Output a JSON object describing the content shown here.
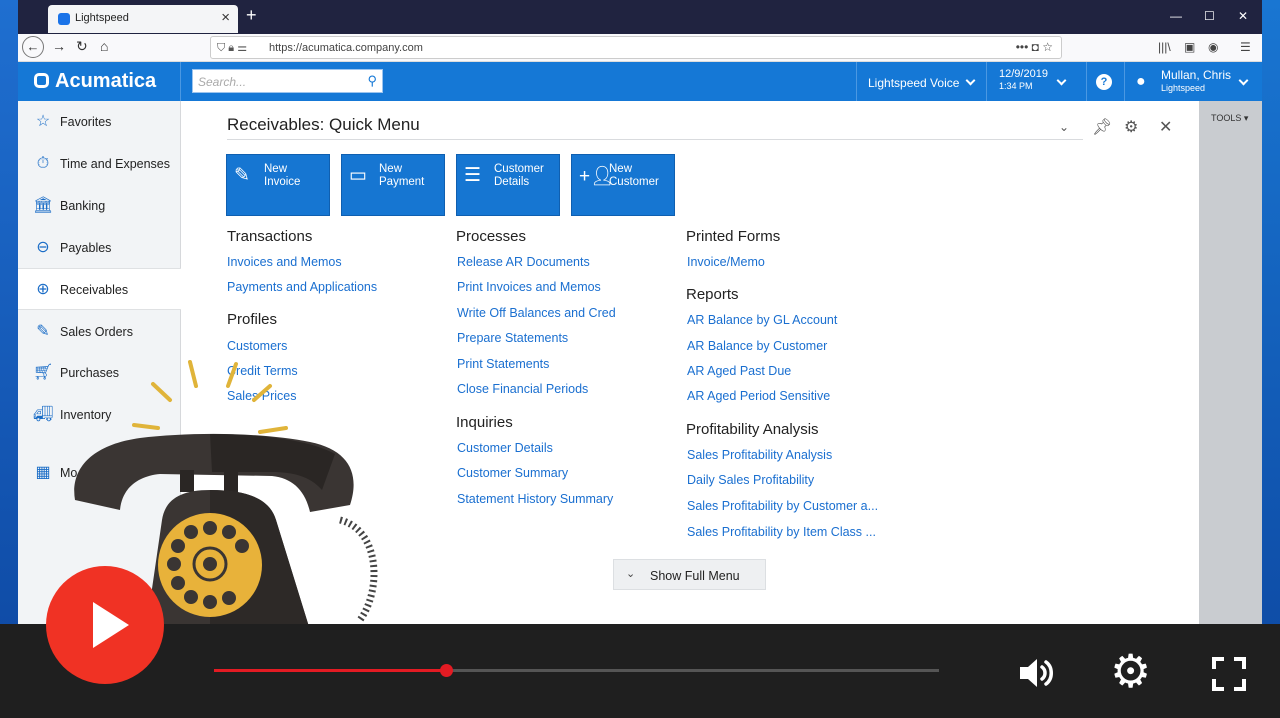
{
  "browser": {
    "tab_title": "Lightspeed",
    "url": "https://acumatica.company.com"
  },
  "app": {
    "brand": "Acumatica",
    "search_placeholder": "Search...",
    "company": "Lightspeed Voice",
    "date": "12/9/2019",
    "time": "1:34 PM",
    "user_name": "Mullan, Chris",
    "user_company": "Lightspeed"
  },
  "sidebar": {
    "items": [
      {
        "label": "Favorites",
        "icon": "star-icon"
      },
      {
        "label": "Time and Expenses",
        "icon": "stopwatch-icon"
      },
      {
        "label": "Banking",
        "icon": "bank-icon"
      },
      {
        "label": "Payables",
        "icon": "minus-circle-icon"
      },
      {
        "label": "Receivables",
        "icon": "plus-circle-icon"
      },
      {
        "label": "Sales Orders",
        "icon": "edit-icon"
      },
      {
        "label": "Purchases",
        "icon": "cart-icon"
      },
      {
        "label": "Inventory",
        "icon": "truck-icon"
      },
      {
        "label": "Mo",
        "icon": "grid-icon"
      }
    ]
  },
  "tools_label": "TOOLS",
  "quick_menu": {
    "title": "Receivables: Quick Menu",
    "tiles": [
      {
        "label": "New Invoice",
        "icon": "edit-icon"
      },
      {
        "label": "New Payment",
        "icon": "card-icon"
      },
      {
        "label": "Customer Details",
        "icon": "list-icon"
      },
      {
        "label": "New Customer",
        "icon": "add-user-icon"
      }
    ],
    "transactions": {
      "title": "Transactions",
      "links": [
        "Invoices and Memos",
        "Payments and Applications"
      ]
    },
    "profiles": {
      "title": "Profiles",
      "links": [
        "Customers",
        "Credit Terms",
        "Sales Prices"
      ]
    },
    "processes": {
      "title": "Processes",
      "links": [
        "Release AR Documents",
        "Print Invoices and Memos",
        "Write Off Balances and Cred",
        "Prepare Statements",
        "Print Statements",
        "Close Financial Periods"
      ]
    },
    "inquiries": {
      "title": "Inquiries",
      "links": [
        "Customer Details",
        "Customer Summary",
        "Statement History Summary"
      ]
    },
    "printed_forms": {
      "title": "Printed Forms",
      "links": [
        "Invoice/Memo"
      ]
    },
    "reports": {
      "title": "Reports",
      "links": [
        "AR Balance by GL Account",
        "AR Balance by Customer",
        "AR Aged Past Due",
        "AR Aged Period Sensitive"
      ]
    },
    "profitability": {
      "title": "Profitability Analysis",
      "links": [
        "Sales Profitability Analysis",
        "Daily Sales Profitability",
        "Sales Profitability by Customer a...",
        "Sales Profitability by Item Class ..."
      ]
    },
    "show_full_menu": "Show Full Menu"
  },
  "video": {
    "progress": 0.32
  }
}
